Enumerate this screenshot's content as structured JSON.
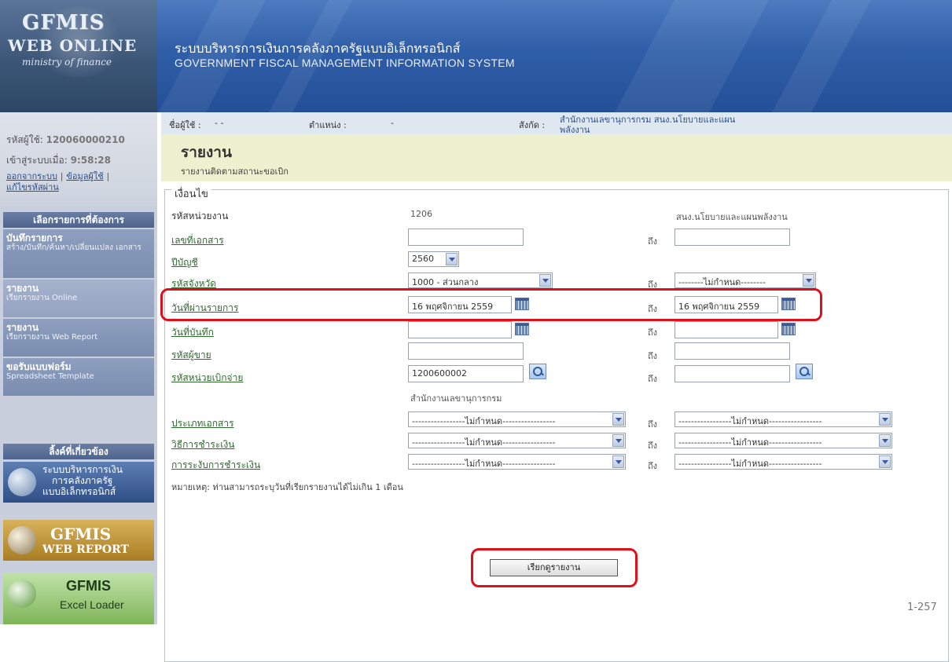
{
  "header": {
    "logo_line1": "GFMIS",
    "logo_line2": "WEB ONLINE",
    "logo_line3": "ministry of finance",
    "title_th": "ระบบบริหารการเงินการคลังภาครัฐแบบอิเล็กทรอนิกส์",
    "title_en": "GOVERNMENT FISCAL MANAGEMENT INFORMATION SYSTEM"
  },
  "user": {
    "id_label": "รหัสผู้ใช้:",
    "id_value": "120060000210",
    "login_label": "เข้าสู่ระบบเมื่อ:",
    "login_value": "9:58:28",
    "logout": "ออกจากระบบ",
    "userinfo": "ข้อมูลผู้ใช้",
    "change_pw": "แก้ไขรหัสผ่าน",
    "sep": "|"
  },
  "sidebar": {
    "menu_header": "เลือกรายการที่ต้องการ",
    "items": [
      {
        "title": "บันทึกรายการ",
        "sub": "สร้าง/บันทึก/ค้นหา/เปลี่ยนแปลง เอกสาร"
      },
      {
        "title": "รายงาน",
        "sub": "เรียกรายงาน Online"
      },
      {
        "title": "รายงาน",
        "sub": "เรียกรายงาน Web Report"
      },
      {
        "title": "ขอรับแบบฟอร์ม",
        "sub": "Spreadsheet Template"
      }
    ],
    "links_header": "ลิ้งค์ที่เกี่ยวข้อง",
    "banners": [
      {
        "line1": "ระบบบริหารการเงิน",
        "line2": "การคลังภาครัฐ",
        "line3": "แบบอิเล็กทรอนิกส์"
      },
      {
        "line1": "GFMIS",
        "line2": "WEB REPORT"
      },
      {
        "line1": "GFMIS",
        "line2": "Excel Loader"
      }
    ],
    "globe_text": "GFMIS"
  },
  "infobar": {
    "user_label": "ชื่อผู้ใช้ :",
    "user_value": "- -",
    "position_label": "ตำแหน่ง :",
    "position_value": "-",
    "org_label": "สังกัด :",
    "org_line1": "สำนักงานเลขานุการกรม สนง.นโยบายและแผน",
    "org_line2": "พลังงาน"
  },
  "page": {
    "title": "รายงาน",
    "subtitle": "รายงานติดตามสถานะขอเบิก",
    "legend": "เงื่อนไข"
  },
  "form": {
    "to": "ถึง",
    "unit_label": "รหัสหน่วยงาน",
    "unit_value": "1206",
    "unit_name": "สนง.นโยบายและแผนพลังงาน",
    "doc_no_label": "เลขที่เอกสาร",
    "fiscal_year_label": "ปีบัญชี",
    "fiscal_year_value": "2560",
    "province_label": "รหัสจังหวัด",
    "province_value": "1000 - ส่วนกลาง",
    "province_to_value": "--------ไม่กำหนด--------",
    "posting_date_label": "วันที่ผ่านรายการ",
    "posting_date_from": "16 พฤศจิกายน 2559",
    "posting_date_to": "16 พฤศจิกายน 2559",
    "entry_date_label": "วันที่บันทึก",
    "vendor_label": "รหัสผู้ขาย",
    "disb_unit_label": "รหัสหน่วยเบิกจ่าย",
    "disb_unit_value": "1200600002",
    "disb_unit_name": "สำนักงานเลขานุการกรม",
    "doc_type_label": "ประเภทเอกสาร",
    "pay_method_label": "วิธีการชำระเงิน",
    "pay_block_label": "การระงับการชำระเงิน",
    "unspecified": "-----------------ไม่กำหนด-----------------",
    "note": "หมายเหตุ: ท่านสามารถระบุวันที่เรียกรายงานได้ไม่เกิน 1 เดือน",
    "submit": "เรียกดูรายงาน"
  },
  "page_number": "1-257",
  "colors": {
    "highlight": "#e0101a",
    "link_green": "#2f6b2f",
    "title_bg": "#eef1cf"
  }
}
